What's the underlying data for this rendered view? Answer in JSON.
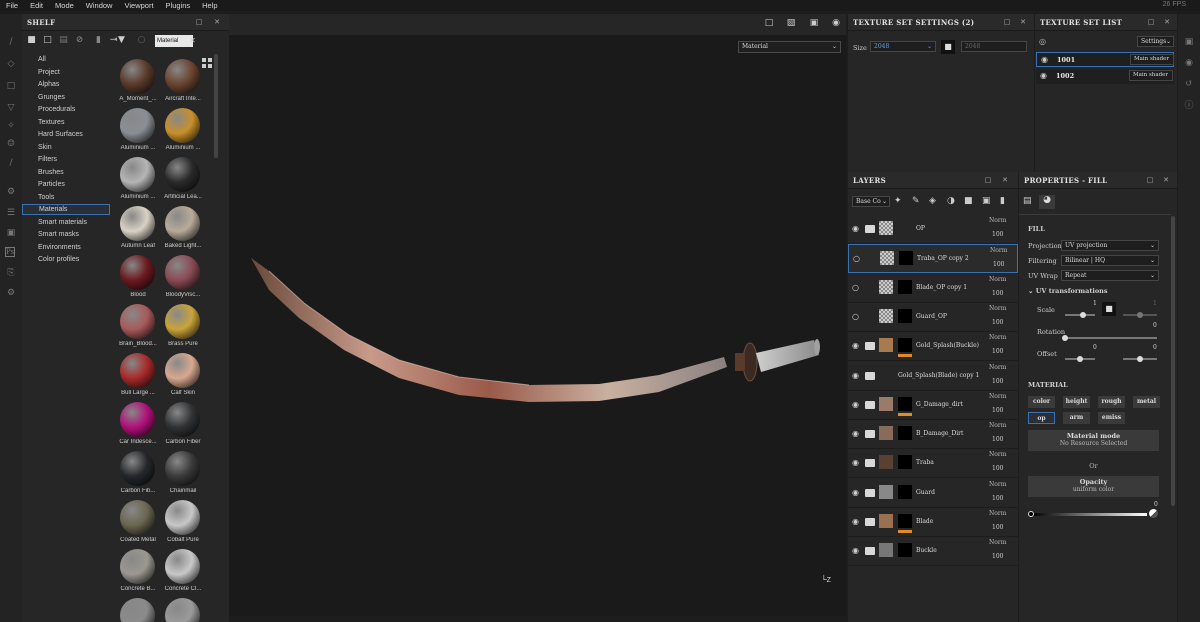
{
  "menu": [
    "File",
    "Edit",
    "Mode",
    "Window",
    "Viewport",
    "Plugins",
    "Help"
  ],
  "fps": "26 FPS",
  "shelf": {
    "title": "SHELF",
    "search_value": "Material",
    "categories": [
      "All",
      "Project",
      "Alphas",
      "Grunges",
      "Procedurals",
      "Textures",
      "Hard Surfaces",
      "Skin",
      "Filters",
      "Brushes",
      "Particles",
      "Tools",
      "Materials",
      "Smart materials",
      "Smart masks",
      "Environments",
      "Color profiles"
    ],
    "selected_category": "Materials",
    "materials": [
      {
        "label": "A_Moment_...",
        "color": "#5a3a2a"
      },
      {
        "label": "Aircraft Inte...",
        "color": "#6a4430"
      },
      {
        "label": "Aluminium ...",
        "color": "#8a8f95"
      },
      {
        "label": "Aluminium ...",
        "color": "#c8902a"
      },
      {
        "label": "Aluminium ...",
        "color": "#b5b5b5"
      },
      {
        "label": "Artificial Lea...",
        "color": "#2a2a2a"
      },
      {
        "label": "Autumn Leaf",
        "color": "#d9d2c4"
      },
      {
        "label": "Baked Light...",
        "color": "#b8ab98"
      },
      {
        "label": "Blood",
        "color": "#6b1a1f"
      },
      {
        "label": "BloodyVisc...",
        "color": "#8a4a55"
      },
      {
        "label": "Brain_Blood...",
        "color": "#a85a5a"
      },
      {
        "label": "Brass Pure",
        "color": "#c9a43a"
      },
      {
        "label": "Bull Large ...",
        "color": "#a82a2a"
      },
      {
        "label": "Calf Skin",
        "color": "#d8a890"
      },
      {
        "label": "Car Iridesce...",
        "color": "#b0107a"
      },
      {
        "label": "Carbon Fiber",
        "color": "#303234"
      },
      {
        "label": "Carbon Fib...",
        "color": "#25272a"
      },
      {
        "label": "Chainmail",
        "color": "#3a3a3a"
      },
      {
        "label": "Coated Metal",
        "color": "#6a6650"
      },
      {
        "label": "Cobalt Pure",
        "color": "#c8c8c8"
      },
      {
        "label": "Concrete B...",
        "color": "#9a9890"
      },
      {
        "label": "Concrete Cl...",
        "color": "#c8c8c8"
      },
      {
        "label": "",
        "color": "#8a8a8a"
      },
      {
        "label": "",
        "color": "#9a9a9a"
      }
    ]
  },
  "viewport": {
    "mode_select": "Material",
    "axis": "Z"
  },
  "texture_set_settings": {
    "title": "TEXTURE SET SETTINGS (2)",
    "size_label": "Size",
    "size_value": "2048",
    "size_value2": "2048"
  },
  "texture_set_list": {
    "title": "TEXTURE SET LIST",
    "settings_btn": "Settings",
    "sets": [
      {
        "name": "1001",
        "shader": "Main shader"
      },
      {
        "name": "1002",
        "shader": "Main shader"
      }
    ]
  },
  "layers": {
    "title": "LAYERS",
    "channel_select": "Base Co",
    "items": [
      {
        "name": "OP",
        "blend": "Norm",
        "opacity": "100",
        "folder": true,
        "visible": true,
        "thumb": "#bbbbbb",
        "mask": false,
        "orange": false,
        "selected": false
      },
      {
        "name": "Traba_OP copy 2",
        "blend": "Norm",
        "opacity": "100",
        "folder": false,
        "visible": false,
        "thumb": "#bbbbbb",
        "mask": true,
        "orange": false,
        "selected": true
      },
      {
        "name": "Blade_OP copy 1",
        "blend": "Norm",
        "opacity": "100",
        "folder": false,
        "visible": false,
        "thumb": "#bbbbbb",
        "mask": true,
        "orange": false,
        "selected": false
      },
      {
        "name": "Guard_OP",
        "blend": "Norm",
        "opacity": "100",
        "folder": false,
        "visible": false,
        "thumb": "#bbbbbb",
        "mask": true,
        "orange": false,
        "selected": false
      },
      {
        "name": "Gold_Splash(Buckle)",
        "blend": "Norm",
        "opacity": "100",
        "folder": true,
        "visible": true,
        "thumb": "#a87a50",
        "mask": true,
        "orange": true,
        "selected": false
      },
      {
        "name": "Gold_Splash(Blade) copy 1",
        "blend": "Norm",
        "opacity": "100",
        "folder": true,
        "visible": true,
        "thumb": "",
        "mask": false,
        "orange": false,
        "selected": false
      },
      {
        "name": "G_Damage_dirt",
        "blend": "Norm",
        "opacity": "100",
        "folder": true,
        "visible": true,
        "thumb": "#9a7a6a",
        "mask": true,
        "orange": true,
        "selected": false
      },
      {
        "name": "B_Damage_Dirt",
        "blend": "Norm",
        "opacity": "100",
        "folder": true,
        "visible": true,
        "thumb": "#8a6a5a",
        "mask": true,
        "orange": false,
        "selected": false
      },
      {
        "name": "Traba",
        "blend": "Norm",
        "opacity": "100",
        "folder": true,
        "visible": true,
        "thumb": "#5a4030",
        "mask": true,
        "orange": false,
        "selected": false
      },
      {
        "name": "Guard",
        "blend": "Norm",
        "opacity": "100",
        "folder": true,
        "visible": true,
        "thumb": "#888888",
        "mask": true,
        "orange": false,
        "selected": false
      },
      {
        "name": "Blade",
        "blend": "Norm",
        "opacity": "100",
        "folder": true,
        "visible": true,
        "thumb": "#9a7050",
        "mask": true,
        "orange": true,
        "selected": false
      },
      {
        "name": "Buckle",
        "blend": "Norm",
        "opacity": "100",
        "folder": true,
        "visible": true,
        "thumb": "#777777",
        "mask": true,
        "orange": false,
        "selected": false
      }
    ]
  },
  "properties": {
    "title": "PROPERTIES - FILL",
    "fill_label": "FILL",
    "projection_label": "Projection",
    "projection_value": "UV projection",
    "filtering_label": "Filtering",
    "filtering_value": "Bilinear | HQ",
    "uvwrap_label": "UV Wrap",
    "uvwrap_value": "Repeat",
    "uvtrans_label": "UV transformations",
    "scale_label": "Scale",
    "scale_value": "1",
    "scale_value2": "1",
    "rotation_label": "Rotation",
    "rotation_value": "0",
    "offset_label": "Offset",
    "offset_value": "0",
    "offset_value2": "0",
    "material_label": "MATERIAL",
    "channels": [
      "color",
      "height",
      "rough",
      "metal",
      "op",
      "arm",
      "emiss"
    ],
    "material_mode_title": "Material mode",
    "material_mode_sub": "No Resource Selected",
    "or_label": "Or",
    "opacity_title": "Opacity",
    "opacity_sub": "uniform color",
    "opacity_value": "0"
  }
}
